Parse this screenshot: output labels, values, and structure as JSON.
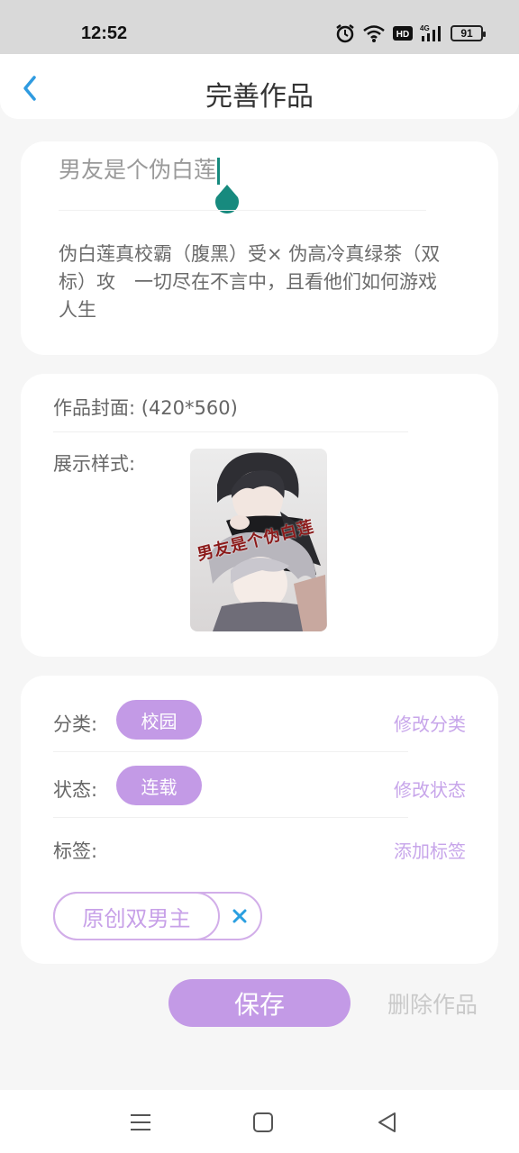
{
  "status_bar": {
    "time": "12:52",
    "battery": "91",
    "icons": [
      "alarm-icon",
      "wifi-icon",
      "hd-icon",
      "signal-4g-icon",
      "battery-icon"
    ]
  },
  "header": {
    "title": "完善作品",
    "back_icon": "chevron-left-icon"
  },
  "work": {
    "title": "男友是个伪白莲",
    "synopsis": "伪白莲真校霸（腹黑）受× 伪高冷真绿茶（双标）攻　一切尽在不言中，且看他们如何游戏人生"
  },
  "cover": {
    "label": "作品封面: (420*560)",
    "style_label": "展示样式:",
    "overlay_title": "男友是个伪白莲"
  },
  "meta": {
    "category_label": "分类:",
    "category_value": "校园",
    "category_action": "修改分类",
    "status_label": "状态:",
    "status_value": "连载",
    "status_action": "修改状态",
    "tags_label": "标签:",
    "tags_action": "添加标签",
    "tags": [
      "原创双男主"
    ]
  },
  "actions": {
    "save": "保存",
    "delete": "删除作品"
  },
  "colors": {
    "accent": "#c39ae6",
    "accent_light": "#c7a5ea",
    "back_arrow": "#2f9be0",
    "caret": "#178a7e",
    "remove_x": "#2a9fe0"
  }
}
